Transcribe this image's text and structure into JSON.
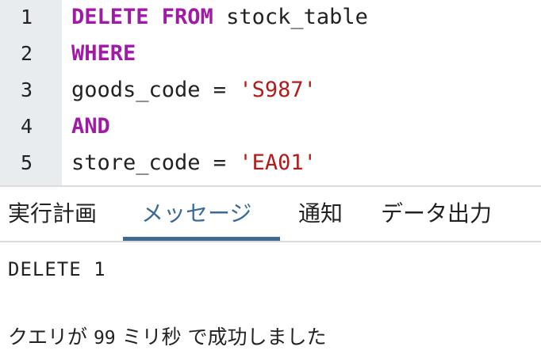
{
  "editor": {
    "lines": [
      {
        "number": "1",
        "kw1": "DELETE FROM",
        "rest": " stock_table"
      },
      {
        "number": "2",
        "kw1": "WHERE"
      },
      {
        "number": "3",
        "text": "goods_code = ",
        "string": "'S987'"
      },
      {
        "number": "4",
        "kw1": "AND"
      },
      {
        "number": "5",
        "text": "store_code = ",
        "string": "'EA01'"
      }
    ]
  },
  "tabs": [
    {
      "label": "実行計画",
      "active": false
    },
    {
      "label": "メッセージ",
      "active": true
    },
    {
      "label": "通知",
      "active": false
    },
    {
      "label": "データ出力",
      "active": false
    }
  ],
  "messages": {
    "result": "DELETE 1",
    "summary_prefix": "クエリが ",
    "summary_ms": "99",
    "summary_suffix": " ミリ秒 で成功しました"
  },
  "colors": {
    "keyword": "#a01aa6",
    "string": "#b41b1b",
    "active_tab": "#3a6a95",
    "gutter_bg": "#e9ecef"
  }
}
